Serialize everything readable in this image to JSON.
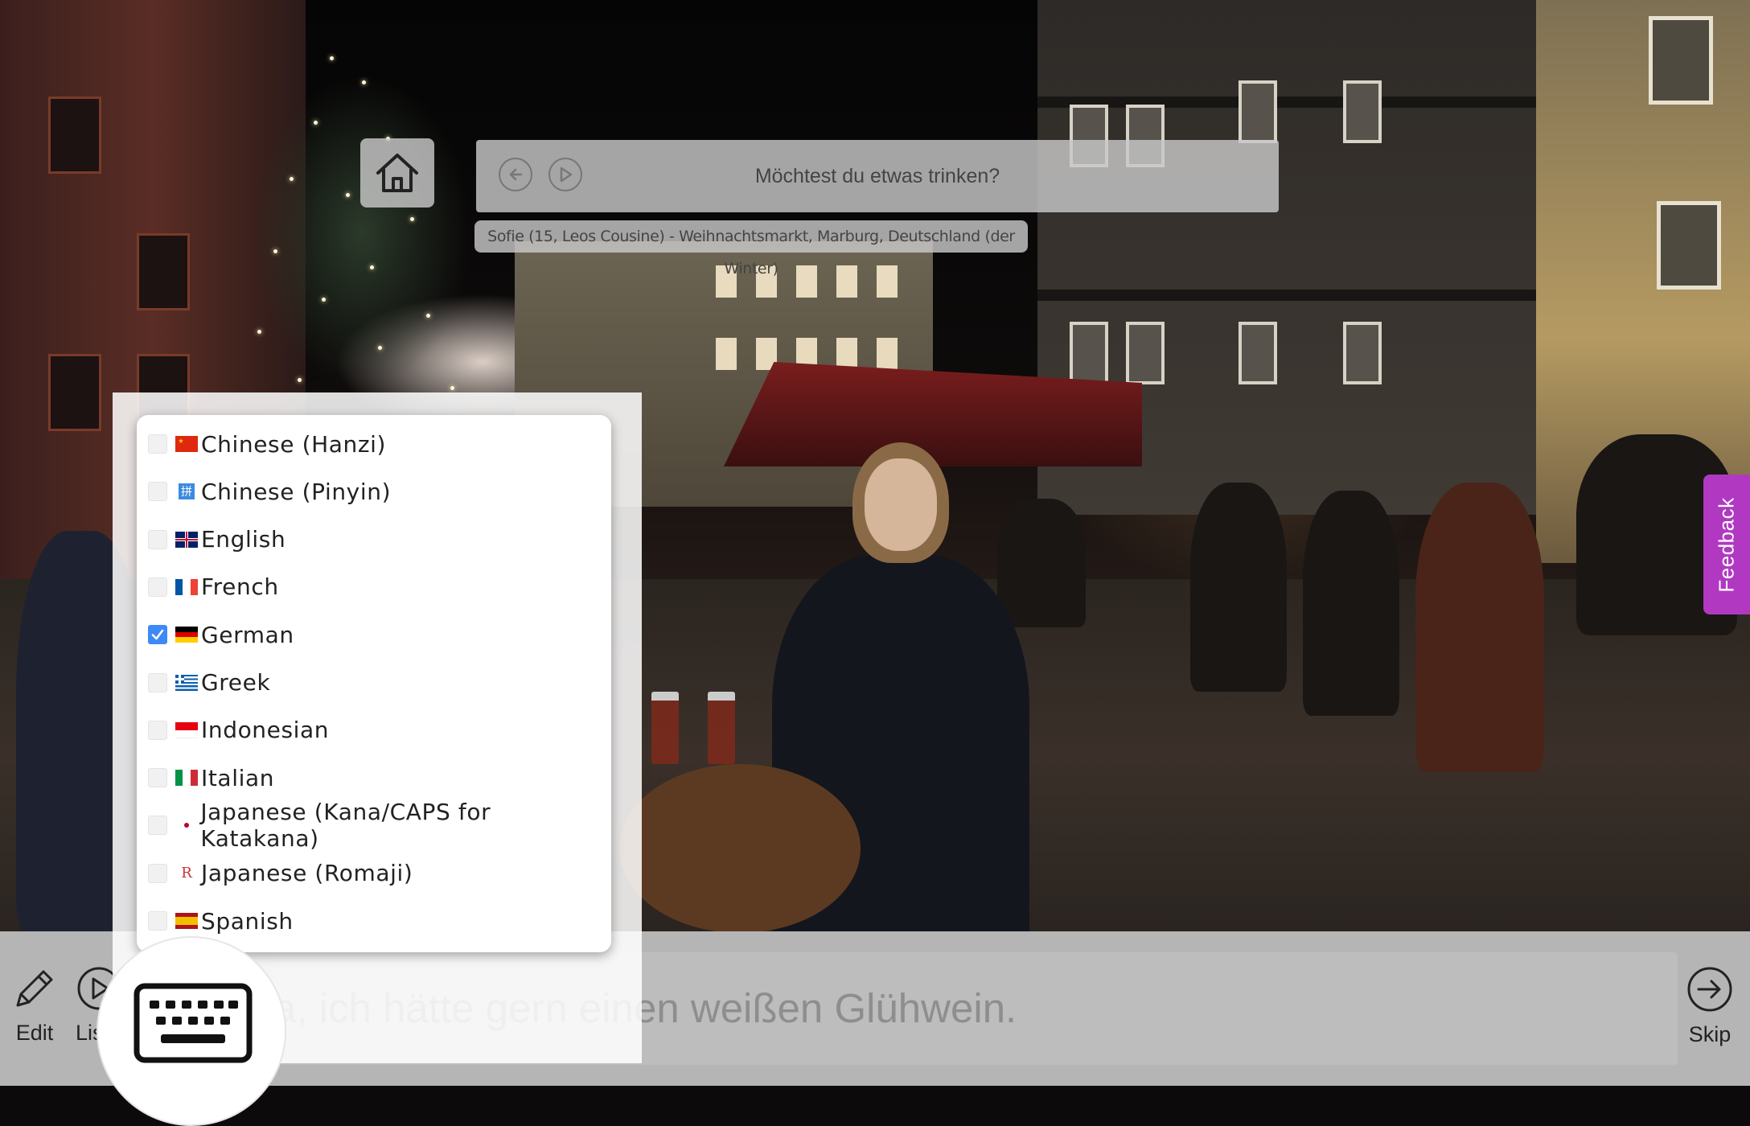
{
  "prompt": {
    "question": "Möchtest du etwas trinken?",
    "caption": "Sofie (15, Leos Cousine) - Weihnachtsmarkt, Marburg, Deutschland (der Winter)"
  },
  "icons": {
    "home": "home-icon",
    "back": "arrow-left-circle-icon",
    "play": "play-circle-icon",
    "edit": "pencil-icon",
    "listen": "play-circle-icon",
    "keyboard": "keyboard-icon",
    "skip": "arrow-right-circle-icon"
  },
  "feedback_tab": {
    "label": "Feedback",
    "color": "#b139c2"
  },
  "language_menu": {
    "items": [
      {
        "label": "Chinese (Hanzi)",
        "checked": false,
        "flag": "cn"
      },
      {
        "label": "Chinese (Pinyin)",
        "checked": false,
        "flag": "pinyin"
      },
      {
        "label": "English",
        "checked": false,
        "flag": "gb"
      },
      {
        "label": "French",
        "checked": false,
        "flag": "fr"
      },
      {
        "label": "German",
        "checked": true,
        "flag": "de"
      },
      {
        "label": "Greek",
        "checked": false,
        "flag": "gr"
      },
      {
        "label": "Indonesian",
        "checked": false,
        "flag": "id"
      },
      {
        "label": "Italian",
        "checked": false,
        "flag": "it"
      },
      {
        "label": "Japanese (Kana/CAPS for Katakana)",
        "checked": false,
        "flag": "jp"
      },
      {
        "label": "Japanese (Romaji)",
        "checked": false,
        "flag": "romaji"
      },
      {
        "label": "Spanish",
        "checked": false,
        "flag": "es"
      }
    ],
    "check_color": "#3d8af7"
  },
  "toolbar": {
    "edit_label": "Edit",
    "listen_label": "Lis",
    "skip_label": "Skip"
  },
  "answer": {
    "text": "a, ich hätte gern einen weißen Glühwein."
  }
}
